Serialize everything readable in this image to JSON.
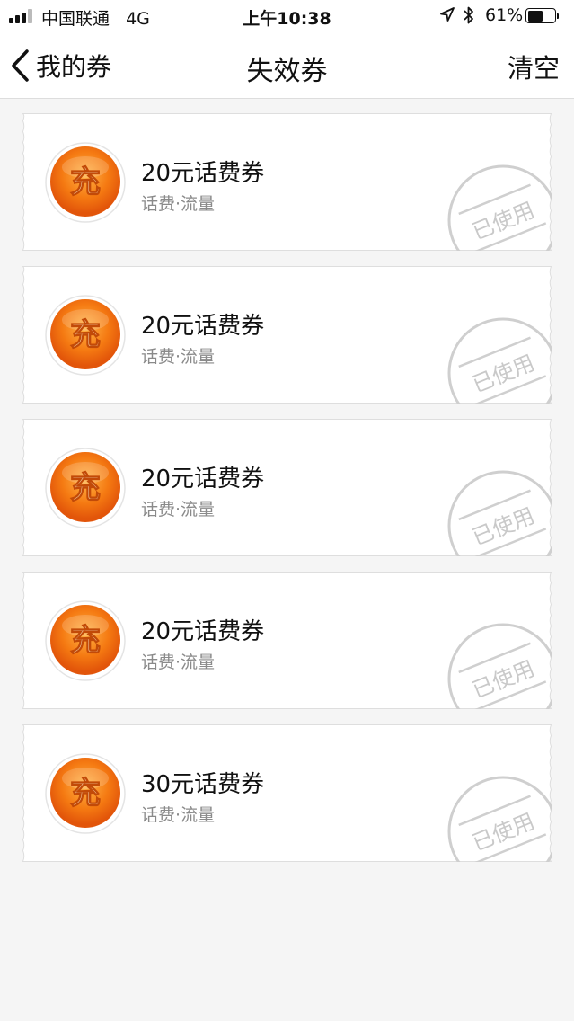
{
  "status_bar": {
    "carrier": "中国联通",
    "network": "4G",
    "time": "上午10:38",
    "battery_percent": "61%",
    "battery_level": 0.61,
    "icons": [
      "signal-icon",
      "location-arrow-icon",
      "bluetooth-icon",
      "battery-icon"
    ]
  },
  "nav": {
    "back_label": "我的券",
    "title": "失效券",
    "clear_label": "清空"
  },
  "badge_char": "充",
  "stamp_text": "已使用",
  "coupons": [
    {
      "title": "20元话费券",
      "category": "话费·流量"
    },
    {
      "title": "20元话费券",
      "category": "话费·流量"
    },
    {
      "title": "20元话费券",
      "category": "话费·流量"
    },
    {
      "title": "20元话费券",
      "category": "话费·流量"
    },
    {
      "title": "30元话费券",
      "category": "话费·流量"
    }
  ],
  "colors": {
    "badge_orange": "#f26a0c",
    "badge_highlight": "#ffb347",
    "stamp_gray": "#cfcfcf",
    "page_background": "#f5f5f5"
  }
}
